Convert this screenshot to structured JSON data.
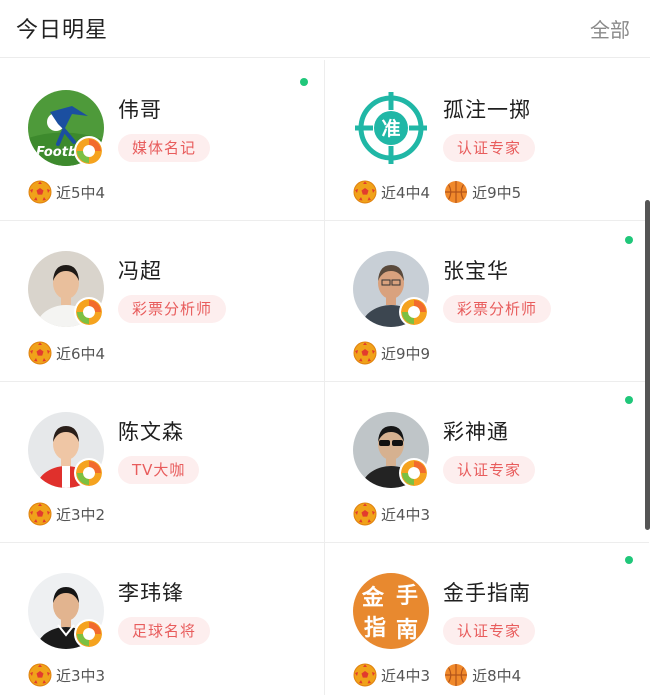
{
  "header": {
    "title": "今日明星",
    "more_label": "全部"
  },
  "icons": {
    "football": "football-icon",
    "basketball": "basketball-icon"
  },
  "colors": {
    "online": "#20c77a",
    "tag_bg": "#fdeeee",
    "tag_text": "#e85c5c"
  },
  "stars": [
    {
      "name": "伟哥",
      "tag": "媒体名记",
      "online": true,
      "avatar": "football-logo-avatar",
      "stats": [
        {
          "sport": "football",
          "text": "近5中4"
        }
      ]
    },
    {
      "name": "孤注一掷",
      "tag": "认证专家",
      "online": false,
      "avatar": "target-zhun-avatar",
      "stats": [
        {
          "sport": "football",
          "text": "近4中4"
        },
        {
          "sport": "basketball",
          "text": "近9中5"
        }
      ]
    },
    {
      "name": "冯超",
      "tag": "彩票分析师",
      "online": false,
      "avatar": "man-white-shirt-avatar",
      "stats": [
        {
          "sport": "football",
          "text": "近6中4"
        }
      ]
    },
    {
      "name": "张宝华",
      "tag": "彩票分析师",
      "online": true,
      "avatar": "man-portrait-avatar",
      "stats": [
        {
          "sport": "football",
          "text": "近9中9"
        }
      ]
    },
    {
      "name": "陈文森",
      "tag": "TV大咖",
      "online": false,
      "avatar": "man-red-jacket-avatar",
      "stats": [
        {
          "sport": "football",
          "text": "近3中2"
        }
      ]
    },
    {
      "name": "彩神通",
      "tag": "认证专家",
      "online": true,
      "avatar": "man-sunglasses-avatar",
      "stats": [
        {
          "sport": "football",
          "text": "近4中3"
        }
      ]
    },
    {
      "name": "李玮锋",
      "tag": "足球名将",
      "online": false,
      "avatar": "man-black-jacket-avatar",
      "stats": [
        {
          "sport": "football",
          "text": "近3中3"
        }
      ]
    },
    {
      "name": "金手指南",
      "tag": "认证专家",
      "online": true,
      "avatar": "jinshou-zhinan-logo-avatar",
      "logo_text": "金手指南",
      "stats": [
        {
          "sport": "football",
          "text": "近4中3"
        },
        {
          "sport": "basketball",
          "text": "近8中4"
        }
      ]
    }
  ]
}
